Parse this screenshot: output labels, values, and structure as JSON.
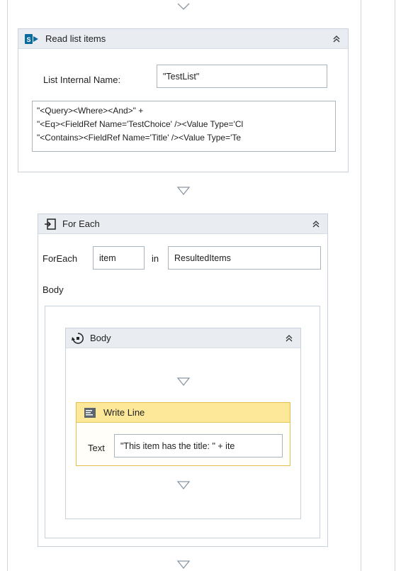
{
  "read_list": {
    "title": "Read list items",
    "internal_name_label": "List Internal Name:",
    "internal_name_value": "\"TestList\"",
    "query_lines": [
      "\"<Query><Where><And>\" +",
      "\"<Eq><FieldRef Name='TestChoice' /><Value Type='Cl",
      "\"<Contains><FieldRef Name='Title' /><Value Type='Te"
    ]
  },
  "for_each": {
    "title": "For Each",
    "foreach_label": "ForEach",
    "item_value": "item",
    "in_label": "in",
    "collection_value": "ResultedItems",
    "body_label": "Body"
  },
  "body_sequence": {
    "title": "Body"
  },
  "write_line": {
    "title": "Write Line",
    "text_label": "Text",
    "text_value": "\"This item has the title: \" + ite"
  },
  "icons": {
    "read_list_icon": "sharepoint-icon",
    "for_each_icon": "foreach-icon",
    "body_icon": "sequence-icon",
    "write_line_icon": "write-line-icon",
    "collapse_icon": "double-chevron-up-icon",
    "arrow_icon": "drop-arrow-icon"
  },
  "colors": {
    "header_bg": "#e9edf2",
    "border": "#c9d2dc",
    "write_line_header": "#fde89a",
    "write_line_border": "#e6bf48",
    "sharepoint_blue": "#0b6a9e"
  }
}
